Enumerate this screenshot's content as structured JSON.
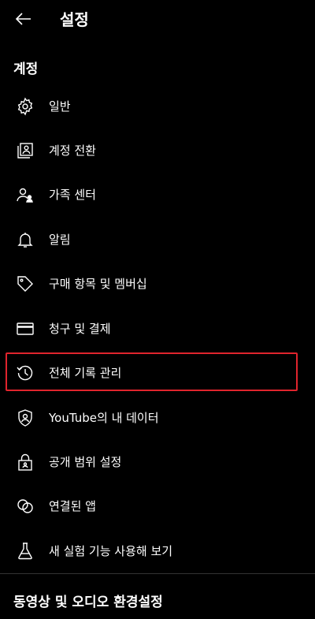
{
  "header": {
    "title": "설정",
    "back_icon": "arrow-left-icon"
  },
  "account": {
    "section_title": "계정",
    "items": [
      {
        "label": "일반",
        "icon": "gear-icon"
      },
      {
        "label": "계정 전환",
        "icon": "switch-account-icon"
      },
      {
        "label": "가족 센터",
        "icon": "family-icon"
      },
      {
        "label": "알림",
        "icon": "bell-icon"
      },
      {
        "label": "구매 항목 및 멤버십",
        "icon": "tag-icon"
      },
      {
        "label": "청구 및 결제",
        "icon": "credit-card-icon"
      },
      {
        "label": "전체 기록 관리",
        "icon": "history-icon",
        "highlighted": true
      },
      {
        "label": "YouTube의 내 데이터",
        "icon": "shield-person-icon"
      },
      {
        "label": "공개 범위 설정",
        "icon": "lock-icon"
      },
      {
        "label": "연결된 앱",
        "icon": "linked-apps-icon"
      },
      {
        "label": "새 실험 기능 사용해 보기",
        "icon": "flask-icon"
      }
    ]
  },
  "video_audio": {
    "section_title": "동영상 및 오디오 환경설정"
  },
  "colors": {
    "background": "#000000",
    "text": "#ffffff",
    "highlight": "#e0242d"
  }
}
